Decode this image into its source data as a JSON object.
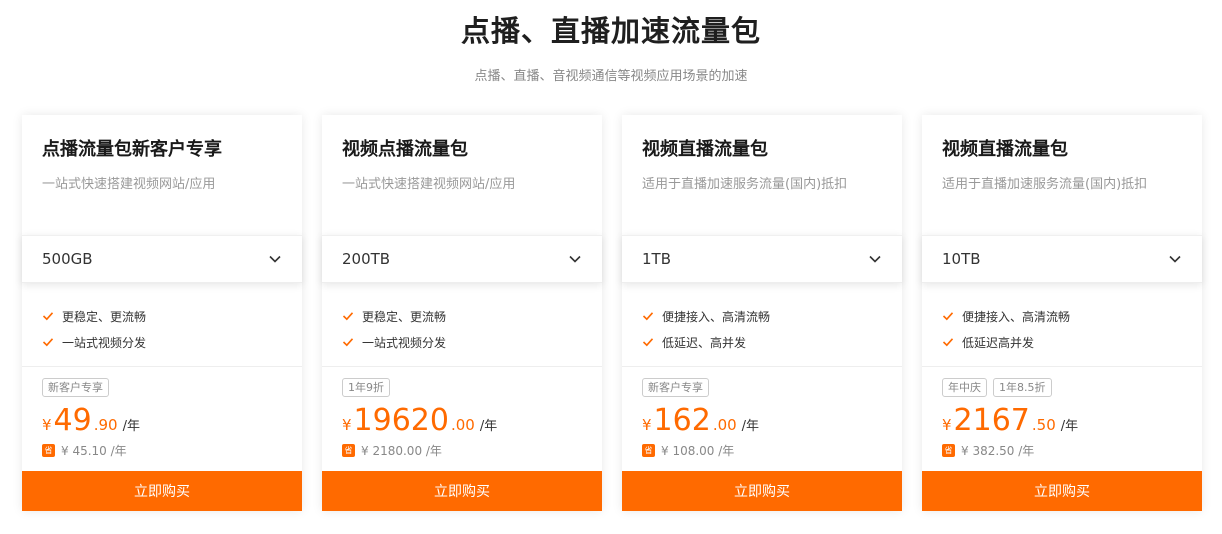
{
  "header": {
    "title": "点播、直播加速流量包",
    "subtitle": "点播、直播、音视频通信等视频应用场景的加速"
  },
  "colors": {
    "accent": "#ff6a00"
  },
  "cards": [
    {
      "title": "点播流量包新客户专享",
      "desc": "一站式快速搭建视频网站/应用",
      "spec": "500GB",
      "features": [
        "更稳定、更流畅",
        "一站式视频分发"
      ],
      "tags": [
        "新客户专享"
      ],
      "price": {
        "currency": "¥",
        "int": "49",
        "dec": ".90",
        "unit": "/年"
      },
      "save_badge": "省",
      "saving": "¥ 45.10 /年",
      "buy_label": "立即购买"
    },
    {
      "title": "视频点播流量包",
      "desc": "一站式快速搭建视频网站/应用",
      "spec": "200TB",
      "features": [
        "更稳定、更流畅",
        "一站式视频分发"
      ],
      "tags": [
        "1年9折"
      ],
      "price": {
        "currency": "¥",
        "int": "19620",
        "dec": ".00",
        "unit": "/年"
      },
      "save_badge": "省",
      "saving": "¥ 2180.00 /年",
      "buy_label": "立即购买"
    },
    {
      "title": "视频直播流量包",
      "desc": "适用于直播加速服务流量(国内)抵扣",
      "spec": "1TB",
      "features": [
        "便捷接入、高清流畅",
        "低延迟、高并发"
      ],
      "tags": [
        "新客户专享"
      ],
      "price": {
        "currency": "¥",
        "int": "162",
        "dec": ".00",
        "unit": "/年"
      },
      "save_badge": "省",
      "saving": "¥ 108.00 /年",
      "buy_label": "立即购买"
    },
    {
      "title": "视频直播流量包",
      "desc": "适用于直播加速服务流量(国内)抵扣",
      "spec": "10TB",
      "features": [
        "便捷接入、高清流畅",
        "低延迟高并发"
      ],
      "tags": [
        "年中庆",
        "1年8.5折"
      ],
      "price": {
        "currency": "¥",
        "int": "2167",
        "dec": ".50",
        "unit": "/年"
      },
      "save_badge": "省",
      "saving": "¥ 382.50 /年",
      "buy_label": "立即购买"
    }
  ]
}
